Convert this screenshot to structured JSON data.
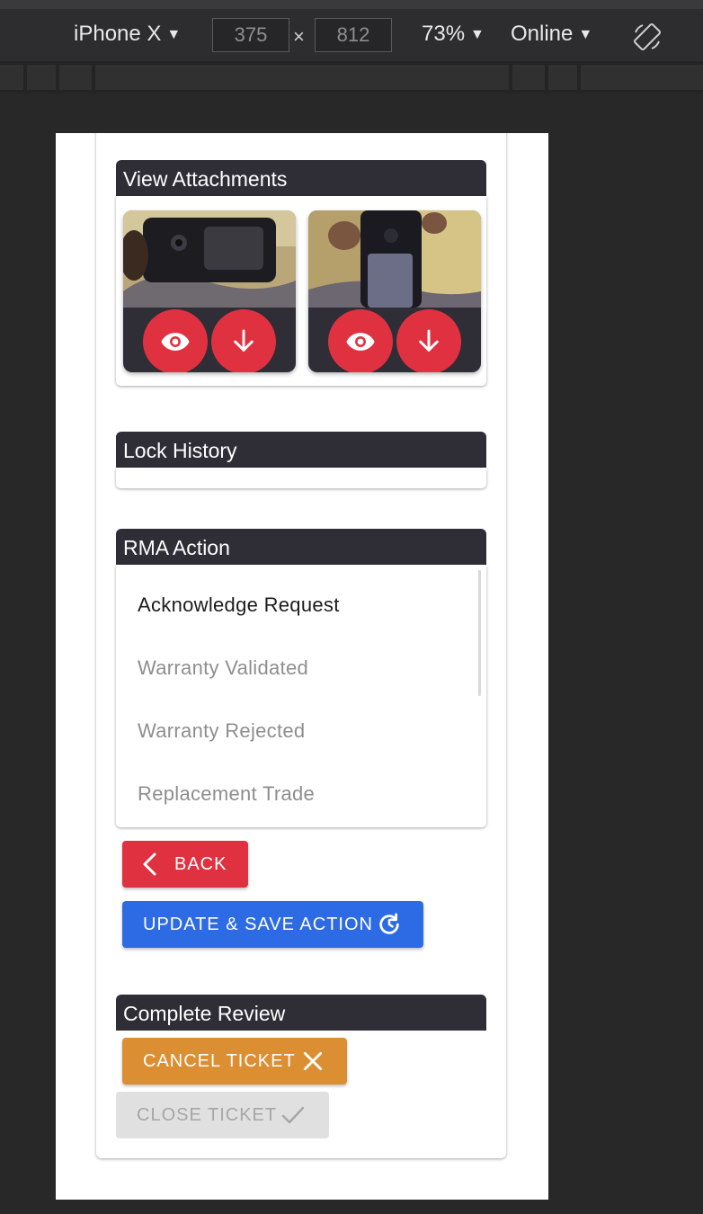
{
  "devtools": {
    "device": "iPhone X",
    "width": "375",
    "height": "812",
    "dim_separator": "×",
    "zoom": "73%",
    "network": "Online",
    "caret": "▼"
  },
  "attachments": {
    "title": "View Attachments",
    "items": [
      {
        "view_icon": "eye-icon",
        "download_icon": "arrow-down-icon"
      },
      {
        "view_icon": "eye-icon",
        "download_icon": "arrow-down-icon"
      }
    ]
  },
  "lock_history": {
    "title": "Lock History"
  },
  "rma_action": {
    "title": "RMA Action",
    "options": [
      {
        "label": "Acknowledge Request",
        "selected": true
      },
      {
        "label": "Warranty Validated",
        "selected": false
      },
      {
        "label": "Warranty Rejected",
        "selected": false
      },
      {
        "label": "Replacement Trade",
        "selected": false
      }
    ],
    "back_label": "BACK",
    "update_label": "UPDATE & SAVE ACTION"
  },
  "complete_review": {
    "title": "Complete Review",
    "cancel_label": "CANCEL TICKET",
    "close_label": "CLOSE TICKET"
  },
  "colors": {
    "header": "#2f2d36",
    "danger": "#e03140",
    "primary": "#2d6be4",
    "warning": "#dc8e33",
    "disabled": "#e0e0e0"
  }
}
